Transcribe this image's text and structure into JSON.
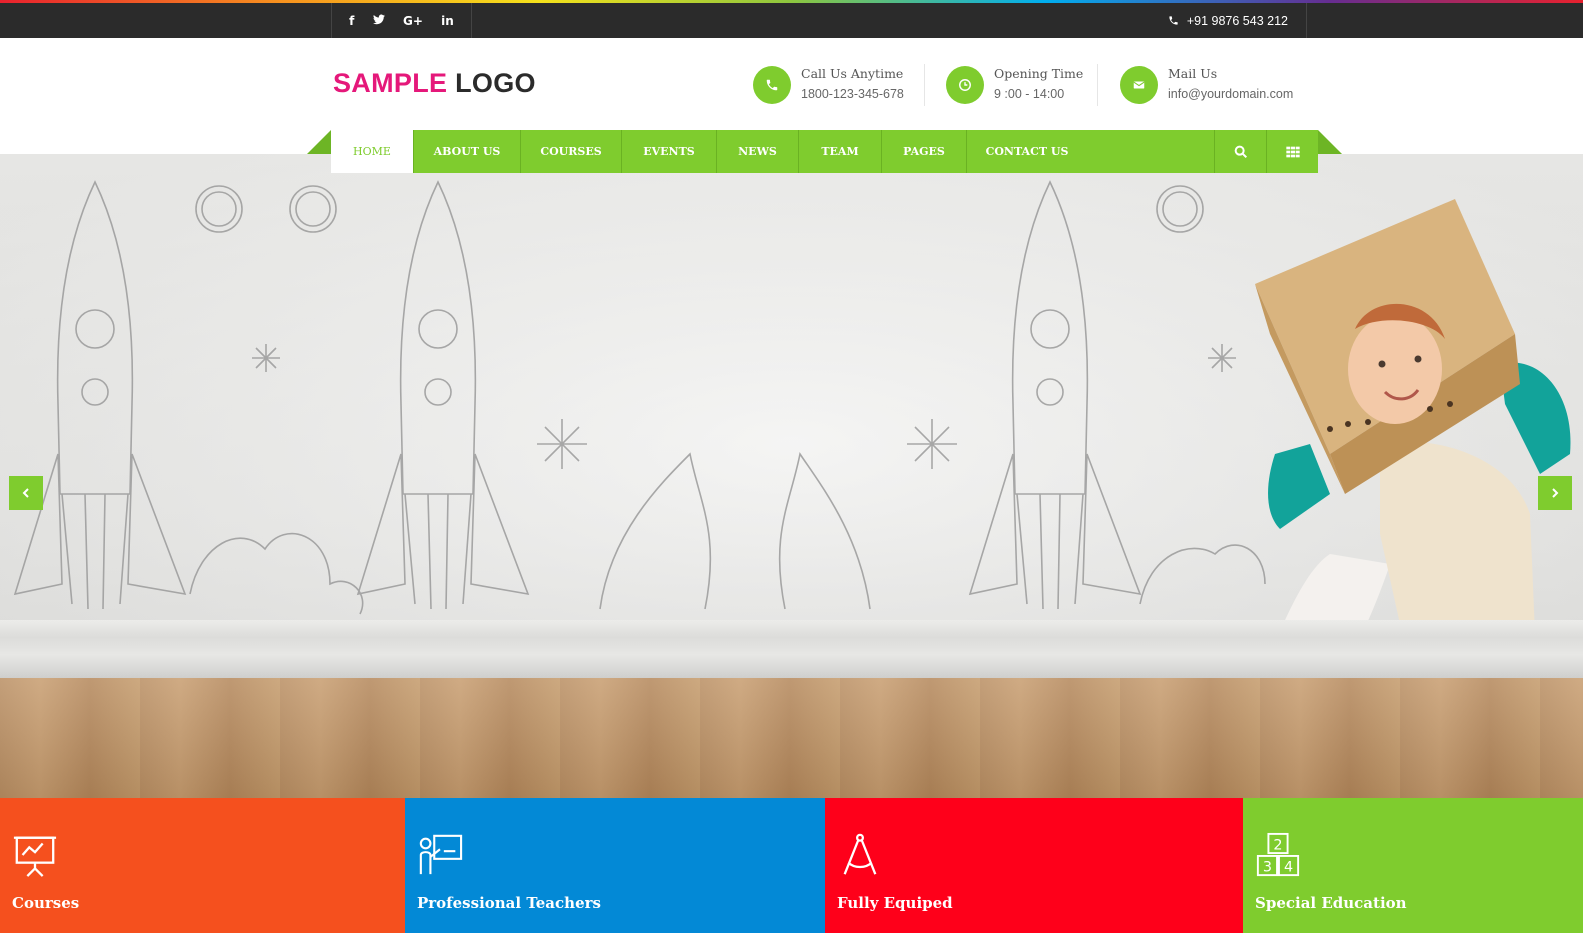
{
  "topbar": {
    "social": [
      {
        "icon": "facebook-icon",
        "glyph": "f"
      },
      {
        "icon": "twitter-icon",
        "glyph": "t"
      },
      {
        "icon": "google-plus-icon",
        "glyph": "G+"
      },
      {
        "icon": "linkedin-icon",
        "glyph": "in"
      }
    ],
    "phone": "+91 9876 543 212"
  },
  "header": {
    "logo_part1": "SAMPLE",
    "logo_part2": "LOGO",
    "contacts": [
      {
        "icon": "phone-icon",
        "title": "Call Us Anytime",
        "value": "1800-123-345-678"
      },
      {
        "icon": "clock-icon",
        "title": "Opening Time",
        "value": "9 :00 - 14:00"
      },
      {
        "icon": "mail-icon",
        "title": "Mail Us",
        "value": "info@yourdomain.com"
      }
    ]
  },
  "nav": {
    "items": [
      "HOME",
      "ABOUT US",
      "COURSES",
      "EVENTS",
      "NEWS",
      "TEAM",
      "PAGES",
      "CONTACT US"
    ],
    "active": "HOME"
  },
  "tiles": [
    {
      "label": "Courses",
      "color": "#f5501e",
      "icon": "presentation-board-icon"
    },
    {
      "label": "Professional Teachers",
      "color": "#0389d6",
      "icon": "teacher-board-icon"
    },
    {
      "label": "Fully Equiped",
      "color": "#fe001a",
      "icon": "compass-icon"
    },
    {
      "label": "Special Education",
      "color": "#7fcc2e",
      "icon": "number-blocks-icon"
    }
  ],
  "colors": {
    "accent": "#7fcc2e",
    "dark": "#2b2b2b",
    "logo_pink": "#e5187a"
  }
}
